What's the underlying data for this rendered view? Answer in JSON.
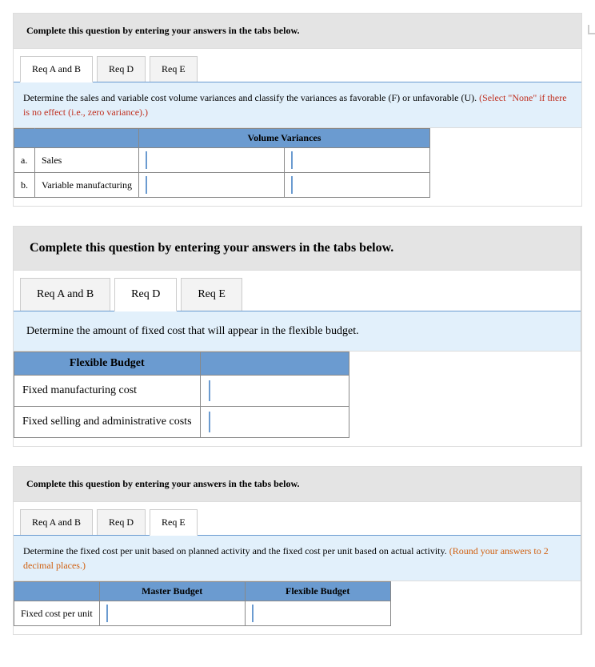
{
  "blocks": [
    {
      "header": "Complete this question by entering your answers in the tabs below.",
      "tabs": [
        "Req A and B",
        "Req D",
        "Req E"
      ],
      "active_tab": 0,
      "instruction_main": "Determine the sales and variable cost volume variances and classify the variances as favorable (F) or unfavorable (U).",
      "instruction_note": "(Select \"None\" if there is no effect (i.e., zero variance).)",
      "table": {
        "header_span": "Volume Variances",
        "rows": [
          {
            "idx": "a.",
            "label": "Sales"
          },
          {
            "idx": "b.",
            "label": "Variable manufacturing"
          }
        ]
      }
    },
    {
      "header": "Complete this question by entering your answers in the tabs below.",
      "tabs": [
        "Req A and B",
        "Req D",
        "Req E"
      ],
      "active_tab": 1,
      "instruction_main": "Determine the amount of fixed cost that will appear in the flexible budget.",
      "instruction_note": "",
      "table": {
        "header_span": "Flexible Budget",
        "rows": [
          {
            "idx": "",
            "label": "Fixed manufacturing cost"
          },
          {
            "idx": "",
            "label": "Fixed selling and administrative costs"
          }
        ]
      }
    },
    {
      "header": "Complete this question by entering your answers in the tabs below.",
      "tabs": [
        "Req A and B",
        "Req D",
        "Req E"
      ],
      "active_tab": 2,
      "instruction_main": "Determine the fixed cost per unit based on planned activity and the fixed cost per unit based on actual activity.",
      "instruction_note": "(Round your answers to 2 decimal places.)",
      "table": {
        "headers": [
          "Master Budget",
          "Flexible Budget"
        ],
        "row_label": "Fixed cost per unit"
      }
    }
  ]
}
